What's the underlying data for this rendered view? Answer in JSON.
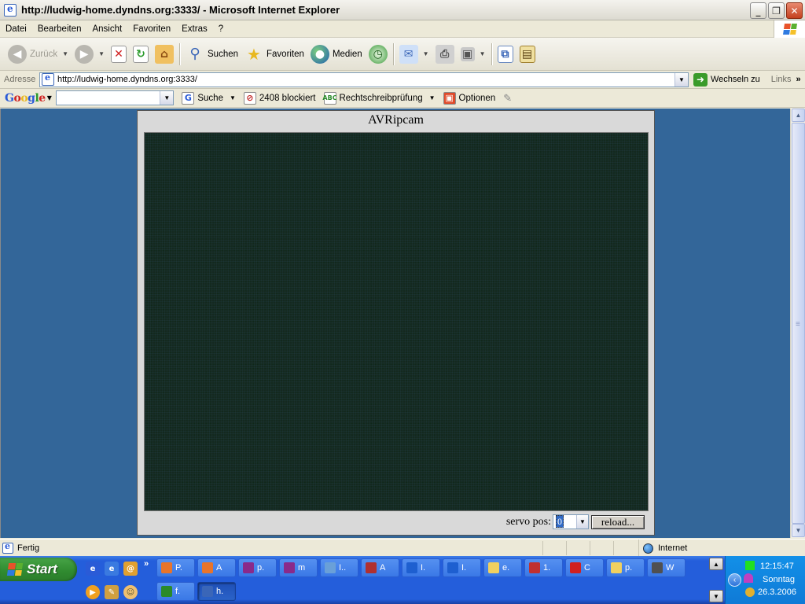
{
  "window": {
    "title": "http://ludwig-home.dyndns.org:3333/ - Microsoft Internet Explorer",
    "buttons": {
      "minimize": "_",
      "maximize": "❐",
      "close": "✕"
    }
  },
  "menu": [
    "Datei",
    "Bearbeiten",
    "Ansicht",
    "Favoriten",
    "Extras",
    "?"
  ],
  "toolbar": {
    "back_label": "Zurück",
    "search_label": "Suchen",
    "favorites_label": "Favoriten",
    "media_label": "Medien"
  },
  "address": {
    "label": "Adresse",
    "url": "http://ludwig-home.dyndns.org:3333/",
    "go_label": "Wechseln zu",
    "links_label": "Links"
  },
  "google_bar": {
    "logo": "Google",
    "search_value": "",
    "search_label": "Suche",
    "blocked_label": "2408 blockiert",
    "spellcheck_label": "Rechtschreibprüfung",
    "options_label": "Optionen"
  },
  "page": {
    "title": "AVRipcam",
    "servo_label": "servo pos:",
    "servo_value": "0",
    "reload_label": "reload..."
  },
  "status": {
    "text": "Fertig",
    "zone": "Internet"
  },
  "taskbar": {
    "start_label": "Start",
    "tasks": [
      {
        "label": "P.",
        "color": "#e8742a"
      },
      {
        "label": "A",
        "color": "#e8742a"
      },
      {
        "label": "p.",
        "color": "#8a2a8a"
      },
      {
        "label": "m",
        "color": "#8a2a8a"
      },
      {
        "label": "I..",
        "color": "#6aa0d8"
      },
      {
        "label": "A",
        "color": "#b03030"
      },
      {
        "label": "I.",
        "color": "#1e5fd0"
      },
      {
        "label": "I.",
        "color": "#1e5fd0"
      },
      {
        "label": "e.",
        "color": "#f0d060"
      },
      {
        "label": "1.",
        "color": "#c03030"
      },
      {
        "label": "C",
        "color": "#d02020"
      },
      {
        "label": "p.",
        "color": "#f0d060"
      },
      {
        "label": "W",
        "color": "#505050"
      }
    ],
    "tasks_row2": [
      {
        "label": "f.",
        "color": "#2a8a2a"
      },
      {
        "label": "h.",
        "color": "#3a66b8"
      }
    ],
    "clock": "12:15:47",
    "day": "Sonntag",
    "date": "26.3.2006"
  }
}
